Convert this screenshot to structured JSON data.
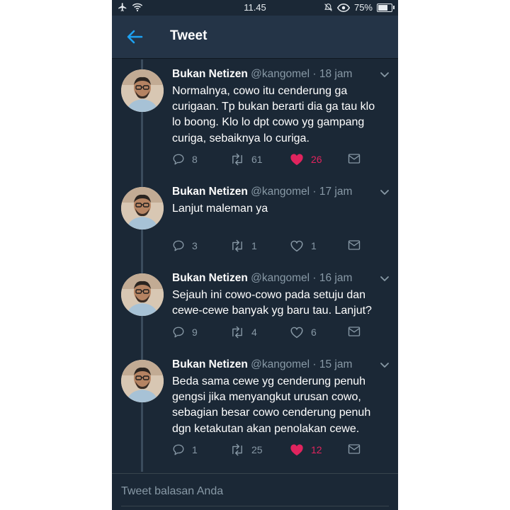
{
  "status_bar": {
    "time": "11.45",
    "battery": "75%",
    "battery_level": 0.75
  },
  "header": {
    "title": "Tweet"
  },
  "tweets": [
    {
      "name": "Bukan Netizen",
      "handle": "@kangomel",
      "sep": "·",
      "time": "18 jam",
      "text": "Normalnya, cowo itu cenderung ga curigaan. Tp bukan berarti dia ga tau klo lo boong. Klo lo dpt cowo yg gampang curiga, sebaiknya lo curiga.",
      "replies": "8",
      "retweets": "61",
      "likes": "26",
      "liked": true
    },
    {
      "name": "Bukan Netizen",
      "handle": "@kangomel",
      "sep": "·",
      "time": "17 jam",
      "text": "Lanjut maleman ya",
      "replies": "3",
      "retweets": "1",
      "likes": "1",
      "liked": false
    },
    {
      "name": "Bukan Netizen",
      "handle": "@kangomel",
      "sep": "·",
      "time": "16 jam",
      "text": "Sejauh ini cowo-cowo pada setuju dan cewe-cewe banyak yg baru tau. Lanjut?",
      "replies": "9",
      "retweets": "4",
      "likes": "6",
      "liked": false
    },
    {
      "name": "Bukan Netizen",
      "handle": "@kangomel",
      "sep": "·",
      "time": "15 jam",
      "text": "Beda sama cewe yg cenderung penuh gengsi jika menyangkut urusan cowo, sebagian besar cowo cenderung penuh dgn ketakutan akan penolakan cewe.",
      "replies": "1",
      "retweets": "25",
      "likes": "12",
      "liked": true
    }
  ],
  "reply": {
    "placeholder": "Tweet balasan Anda"
  },
  "colors": {
    "background": "#1b2836",
    "header": "#243447",
    "accent": "#1da1f2",
    "like": "#e0245e",
    "muted": "#8899a6"
  }
}
